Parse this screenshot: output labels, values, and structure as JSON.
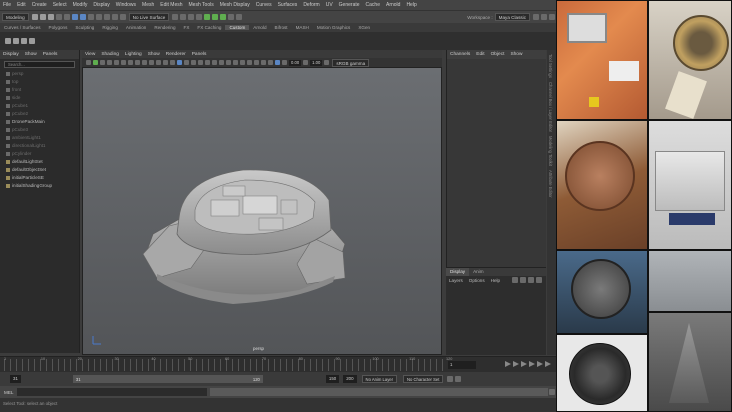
{
  "menubar": {
    "items": [
      "File",
      "Edit",
      "Create",
      "Select",
      "Modify",
      "Display",
      "Windows",
      "Mesh",
      "Edit Mesh",
      "Mesh Tools",
      "Mesh Display",
      "Curves",
      "Surfaces",
      "Deform",
      "UV",
      "Generate",
      "Cache",
      "Arnold",
      "Help"
    ],
    "workspace_label": "Workspace :",
    "workspace_value": "Maya Classic"
  },
  "statusline": {
    "mode": "Modeling",
    "live_surface": "No Live Surface"
  },
  "shelf": {
    "tabs": [
      "Curves / Surfaces",
      "Polygons",
      "Sculpting",
      "Rigging",
      "Animation",
      "Rendering",
      "FX",
      "FX Caching",
      "Custom",
      "Arnold",
      "Bifrost",
      "MASH",
      "Motion Graphics",
      "XGen"
    ],
    "active": "Custom"
  },
  "outliner": {
    "menu": [
      "Display",
      "Show",
      "Panels"
    ],
    "search_placeholder": "Search...",
    "items": [
      {
        "label": "persp",
        "dim": true
      },
      {
        "label": "top",
        "dim": true
      },
      {
        "label": "front",
        "dim": true
      },
      {
        "label": "side",
        "dim": true
      },
      {
        "label": "pCube1",
        "dim": true
      },
      {
        "label": "pCube2",
        "dim": true
      },
      {
        "label": "DronePackMain",
        "dim": false
      },
      {
        "label": "pCube3",
        "dim": true
      },
      {
        "label": "ambientLight1",
        "dim": true
      },
      {
        "label": "directionalLight1",
        "dim": true
      },
      {
        "label": "pCylinder",
        "dim": true
      },
      {
        "label": "defaultLightSet",
        "dim": false,
        "set": true
      },
      {
        "label": "defaultObjectSet",
        "dim": false,
        "set": true
      },
      {
        "label": "initialParticleSE",
        "dim": false,
        "set": true
      },
      {
        "label": "initialShadingGroup",
        "dim": false,
        "set": true
      }
    ]
  },
  "viewport": {
    "menu": [
      "View",
      "Shading",
      "Lighting",
      "Show",
      "Renderer",
      "Panels"
    ],
    "camera_label": "persp",
    "near_value": "0.00",
    "far_value": "1.00",
    "color_space": "sRGB gamma"
  },
  "channelbox": {
    "menu": [
      "Channels",
      "Edit",
      "Object",
      "Show"
    ]
  },
  "layers": {
    "tabs": [
      "Display",
      "Anim"
    ],
    "active": "Display",
    "menu": [
      "Layers",
      "Options",
      "Help"
    ]
  },
  "sidetabs": [
    "Tool Settings",
    "Channel Box / Layer Editor",
    "Modeling Toolkit",
    "Attribute Editor"
  ],
  "timeslider": {
    "ticks": [
      "1",
      "10",
      "20",
      "30",
      "40",
      "50",
      "60",
      "70",
      "80",
      "90",
      "100",
      "110",
      "120"
    ],
    "current_frame": "1"
  },
  "range": {
    "start": "31",
    "inner_start": "31",
    "inner_end": "120",
    "end_a": "150",
    "end_b": "200",
    "anim_layer": "No Anim Layer",
    "character_set": "No Character Set"
  },
  "cmdline": {
    "language": "MEL"
  },
  "helpline": "Select Tool: select an object"
}
